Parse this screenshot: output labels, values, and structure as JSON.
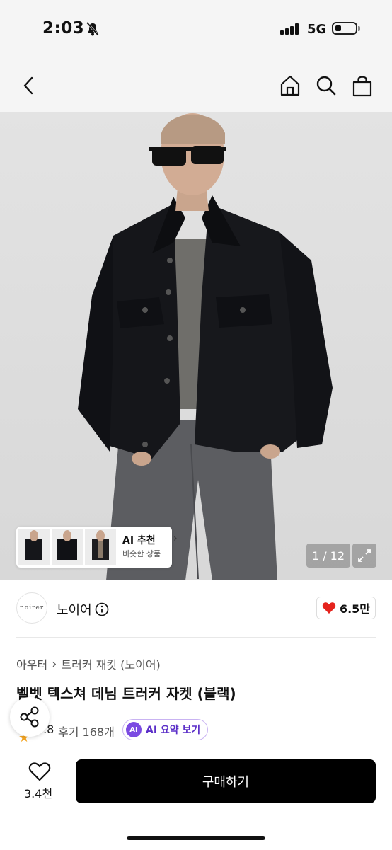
{
  "status": {
    "time": "2:03",
    "network": "5G"
  },
  "icons": {
    "back": "chevron-left-icon",
    "home": "home-icon",
    "search": "search-icon",
    "bag": "shopping-bag-icon",
    "info": "info-icon",
    "heart": "heart-icon",
    "share": "share-icon",
    "expand": "expand-icon"
  },
  "gallery": {
    "counter": "1 / 12",
    "ai_title": "AI 추천",
    "ai_subtitle": "비슷한 상품"
  },
  "seller": {
    "logo_text": "noirer",
    "name": "노이어",
    "likes": "6.5만"
  },
  "breadcrumb": {
    "category": "아우터",
    "subcategory": "트러커 재킷 (노이어)"
  },
  "product": {
    "title": "벨벳 텍스쳐 데님 트러커 자켓 (블랙)",
    "rating": "..8",
    "reviews": "후기 168개",
    "ai_badge": "AI",
    "ai_summary": "AI 요약 보기"
  },
  "bottom": {
    "wish_count": "3.4천",
    "buy_label": "구매하기"
  },
  "colors": {
    "accent_purple": "#7b4ae2",
    "heart_red": "#e5231d",
    "button_black": "#000000"
  }
}
